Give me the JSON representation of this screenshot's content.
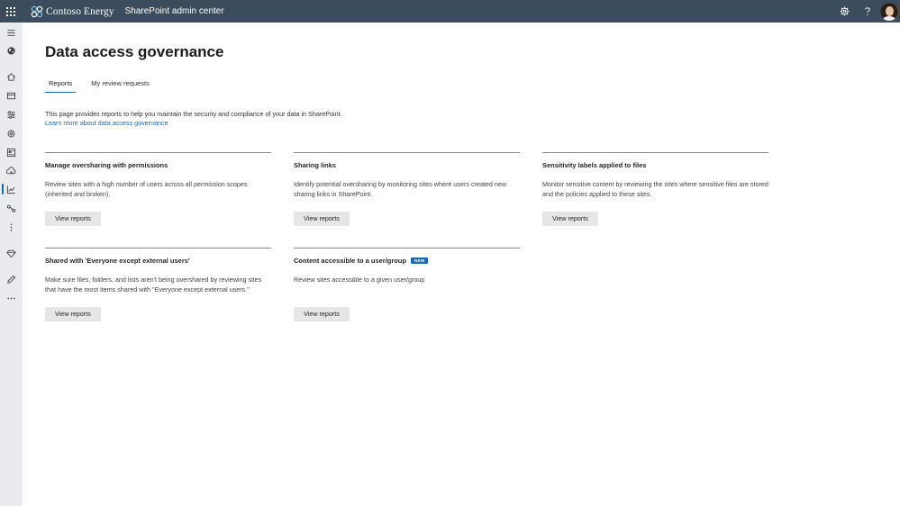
{
  "topbar": {
    "brand": "Contoso Energy",
    "app": "SharePoint admin center",
    "icons": [
      "waffle-icon",
      "settings-icon",
      "help-icon",
      "avatar"
    ]
  },
  "leftnav": {
    "items": [
      {
        "icon": "hamburger-icon"
      },
      {
        "icon": "globe-icon"
      },
      {
        "icon": "home-icon"
      },
      {
        "icon": "sites-icon"
      },
      {
        "icon": "policies-icon"
      },
      {
        "icon": "settings-icon"
      },
      {
        "icon": "content-services-icon"
      },
      {
        "icon": "migration-icon"
      },
      {
        "icon": "reports-icon",
        "active": true
      },
      {
        "icon": "connections-icon"
      },
      {
        "icon": "more-vertical-icon"
      },
      {
        "icon": "premium-icon"
      },
      {
        "icon": "edit-icon"
      },
      {
        "icon": "more-horizontal-icon"
      }
    ]
  },
  "page": {
    "title": "Data access governance",
    "tabs": [
      {
        "label": "Reports",
        "active": true
      },
      {
        "label": "My review requests",
        "active": false
      }
    ],
    "intro": "This page provides reports to help you maintain the security and compliance of your data in SharePoint.",
    "learn_more": "Learn more about data access governance"
  },
  "cards": [
    {
      "title": "Manage oversharing with permissions",
      "desc": "Review sites with a high number of users across all permission scopes (inherited and broken).",
      "button": "View reports"
    },
    {
      "title": "Sharing links",
      "desc": "Identify potential oversharing by monitoring sites where users created new sharing links in SharePoint.",
      "button": "View reports"
    },
    {
      "title": "Sensitivity labels applied to files",
      "desc": "Monitor sensitive content by reviewing the sites where sensitive files are stored and the policies applied to these sites.",
      "button": "View reports"
    },
    {
      "title": "Shared with 'Everyone except external users'",
      "desc": "Make sure files, folders, and lists aren't being overshared by reviewing sites that have the most items shared with \"Everyone except external users.\"",
      "button": "View reports"
    },
    {
      "title": "Content accessible to a user/group",
      "badge": "NEW",
      "desc": "Review sites accessible to a given user/group",
      "button": "View reports"
    }
  ],
  "colors": {
    "topbar": "#3b4c5c",
    "accent": "#0f6cbd",
    "nav_bg": "#e9ebee"
  }
}
